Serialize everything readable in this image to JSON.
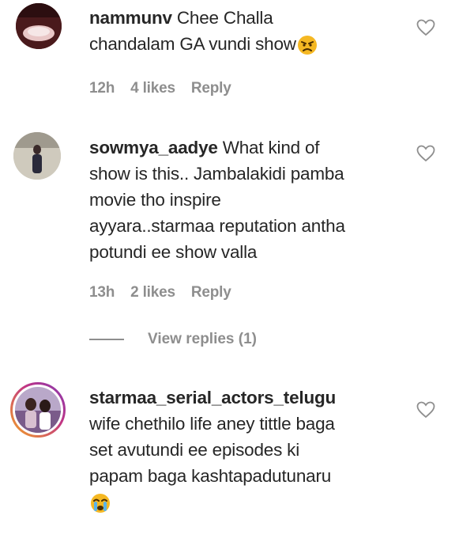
{
  "comments": [
    {
      "username": "nammunv",
      "text": "Chee Challa chandalam GA vundi show",
      "line1_rest": "Chee Challa",
      "line2": "chandalam GA vundi show",
      "emoji": "angry-face-icon",
      "time": "12h",
      "likes": "4 likes",
      "reply": "Reply"
    },
    {
      "username": "sowmya_aadye",
      "line1_rest": "What kind of",
      "line2": "show is this.. Jambalakidi pamba",
      "line3": "movie tho inspire",
      "line4": "ayyara..starmaa reputation antha",
      "line5": "potundi ee show valla",
      "time": "13h",
      "likes": "2 likes",
      "reply": "Reply",
      "view_replies": "View replies (1)"
    },
    {
      "username": "starmaa_serial_actors_telugu",
      "line2": "wife chethilo life aney tittle baga",
      "line3": "set avutundi ee episodes ki",
      "line4": "papam baga kashtapadutunaru",
      "emoji": "crying-face-icon"
    }
  ],
  "colors": {
    "text": "#262626",
    "meta": "#8e8e8e",
    "story_ring_start": "#c13584",
    "story_ring_end": "#f5a623"
  }
}
